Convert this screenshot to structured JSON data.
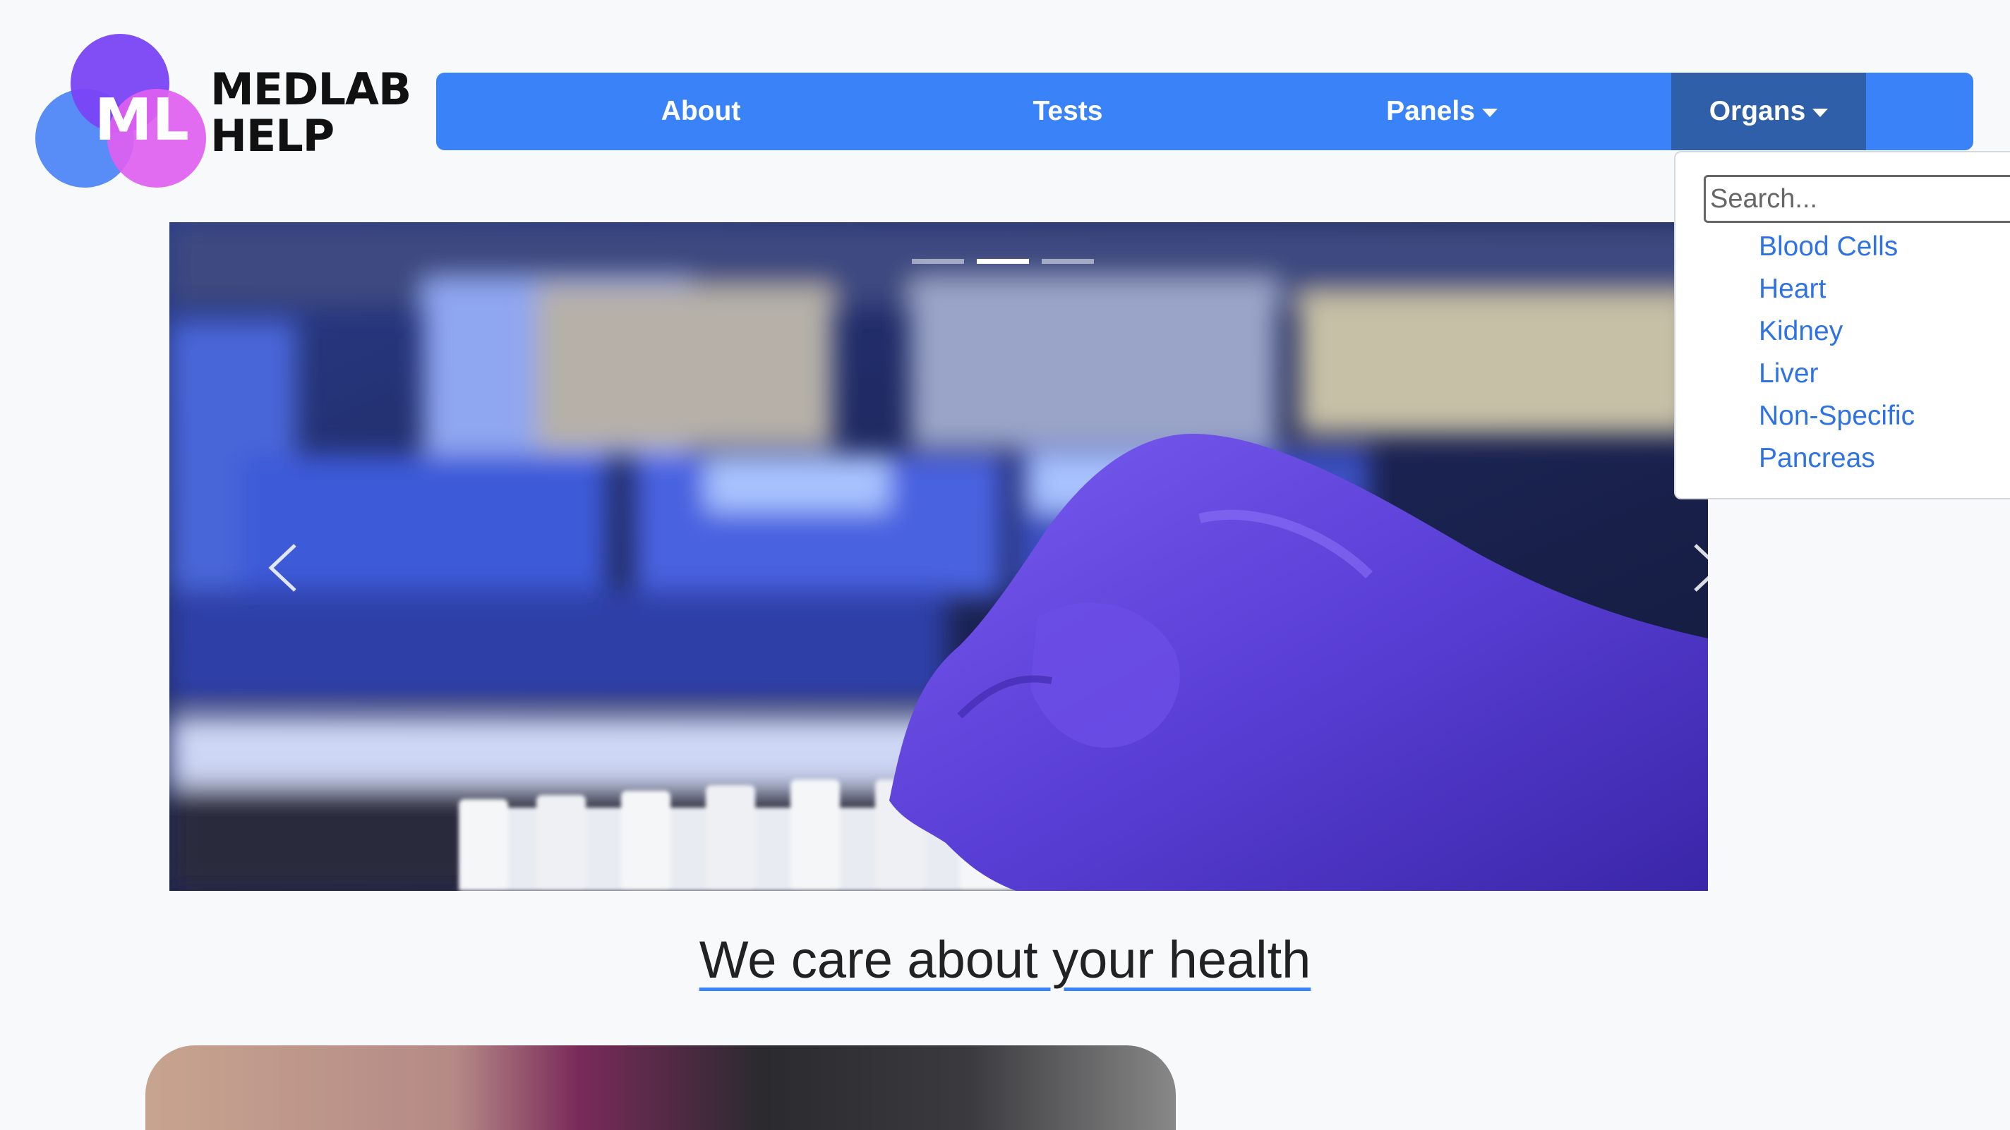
{
  "brand": {
    "logo_monogram": "ML",
    "line1": "MEDLAB",
    "line2": "HELP"
  },
  "nav": {
    "about": "About",
    "tests": "Tests",
    "panels": "Panels",
    "organs": "Organs"
  },
  "organs_dropdown": {
    "search_placeholder": "Search...",
    "items": [
      "Blood Cells",
      "Heart",
      "Kidney",
      "Liver",
      "Non-Specific",
      "Pancreas"
    ]
  },
  "carousel": {
    "slide_count": 3,
    "active_slide": 2
  },
  "headline": "We care about your health",
  "colors": {
    "primary": "#3a82f7",
    "nav_active": "#2f5fa8",
    "link": "#2f73e3",
    "page_bg": "#f8f9fa"
  }
}
